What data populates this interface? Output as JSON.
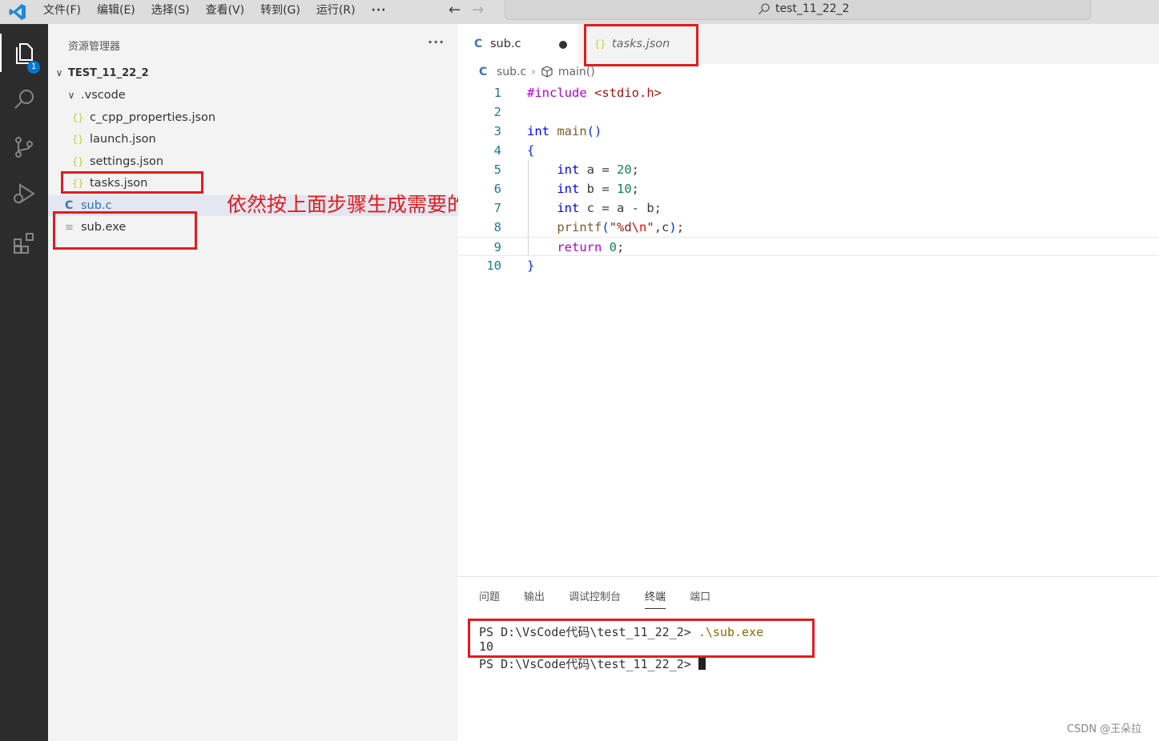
{
  "menu": {
    "items": [
      "文件(F)",
      "编辑(E)",
      "选择(S)",
      "查看(V)",
      "转到(G)",
      "运行(R)"
    ],
    "more": "···"
  },
  "command_center": {
    "text": "test_11_22_2"
  },
  "activity": {
    "explorer_badge": "1"
  },
  "explorer": {
    "title": "资源管理器",
    "more": "···",
    "root": "TEST_11_22_2",
    "folder": ".vscode",
    "files": {
      "c_cpp": "c_cpp_properties.json",
      "launch": "launch.json",
      "settings": "settings.json",
      "tasks": "tasks.json",
      "sub_c": "sub.c",
      "sub_exe": "sub.exe"
    },
    "icons": {
      "json": "{}",
      "c": "C",
      "exe": "≡"
    }
  },
  "annotation": "依然按上面步骤生成需要的",
  "tabs": {
    "active": {
      "icon": "C",
      "label": "sub.c"
    },
    "inactive": {
      "icon": "{}",
      "label": "tasks.json"
    }
  },
  "breadcrumb": {
    "file": "sub.c",
    "symbol": "main()"
  },
  "code": {
    "line_numbers": [
      "1",
      "2",
      "3",
      "4",
      "5",
      "6",
      "7",
      "8",
      "9",
      "10"
    ],
    "l1": {
      "directive": "#include",
      "header": "<stdio.h>"
    },
    "l3": {
      "type": "int",
      "name": "main",
      "parens": "()"
    },
    "l4": "{",
    "l5": {
      "type": "int",
      "rest": " a = ",
      "num": "20",
      "end": ";"
    },
    "l6": {
      "type": "int",
      "rest": " b = ",
      "num": "10",
      "end": ";"
    },
    "l7": {
      "type": "int",
      "rest": " c = a - b;"
    },
    "l8": {
      "fn": "printf",
      "open": "(",
      "q1": "\"%d",
      "esc": "\\n",
      "q2": "\"",
      "rest": ",c",
      "close": ")",
      "end": ";"
    },
    "l9": {
      "kw": "return",
      "sp": " ",
      "num": "0",
      "end": ";"
    },
    "l10": "}"
  },
  "panel": {
    "tabs": [
      "问题",
      "输出",
      "调试控制台",
      "终端",
      "端口"
    ],
    "active_tab": "终端",
    "terminal": {
      "prompt1": "PS D:\\VsCode代码\\test_11_22_2> ",
      "cmd1": ".\\sub.exe",
      "output": "10",
      "prompt2": "PS D:\\VsCode代码\\test_11_22_2> "
    }
  },
  "watermark": "CSDN @王朵拉",
  "colors": {
    "annotation_red": "#e31b1b",
    "accent": "#0078d4"
  }
}
